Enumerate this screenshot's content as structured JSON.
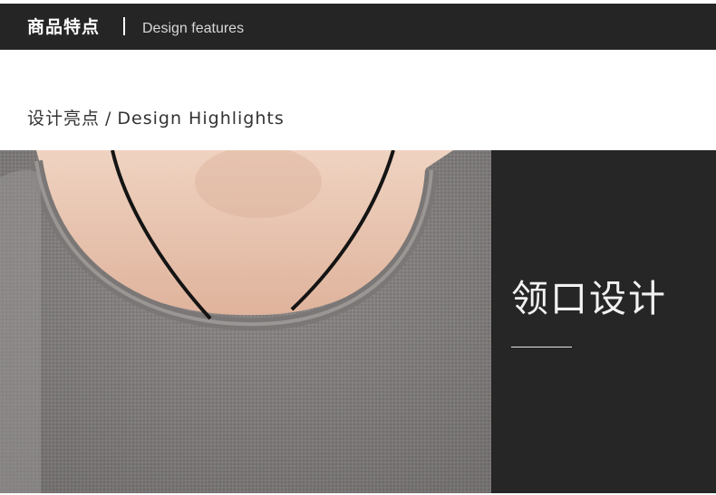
{
  "header": {
    "title_cn": "商品特点",
    "title_en": "Design features"
  },
  "section": {
    "title_cn": "设计亮点",
    "separator": "/",
    "title_en": "Design Highlights"
  },
  "feature": {
    "title": "领口设计"
  },
  "colors": {
    "header_bg": "#252525",
    "panel_bg": "#262626",
    "shirt": "#8a8786",
    "skin": "#e7c3ad",
    "cord": "#141414"
  }
}
